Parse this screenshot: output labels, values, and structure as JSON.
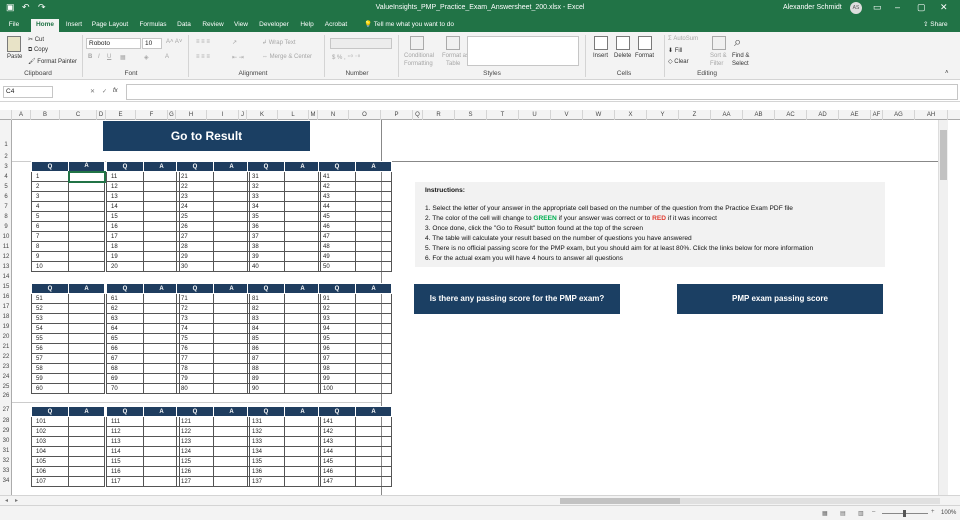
{
  "window": {
    "title": "ValueInsights_PMP_Practice_Exam_Answersheet_200.xlsx  -  Excel",
    "user": "Alexander Schmidt",
    "avatar": "AS"
  },
  "tabs": [
    "File",
    "Home",
    "Insert",
    "Page Layout",
    "Formulas",
    "Data",
    "Review",
    "View",
    "Developer",
    "Help",
    "Acrobat"
  ],
  "tell_me": "Tell me what you want to do",
  "share": "Share",
  "ribbon": {
    "clipboard": {
      "paste": "Paste",
      "cut": "Cut",
      "copy": "Copy",
      "format_painter": "Format Painter",
      "group": "Clipboard"
    },
    "font": {
      "name": "Roboto",
      "size": "10",
      "group": "Font"
    },
    "alignment": {
      "wrap": "Wrap Text",
      "merge": "Merge & Center",
      "group": "Alignment"
    },
    "number": {
      "group": "Number"
    },
    "styles": {
      "conditional": "Conditional",
      "formatting": "Formatting",
      "format_as": "Format as",
      "table": "Table",
      "group": "Styles"
    },
    "cells": {
      "insert": "Insert",
      "delete": "Delete",
      "format": "Format",
      "group": "Cells"
    },
    "editing": {
      "autosum": "AutoSum",
      "fill": "Fill",
      "clear": "Clear",
      "sort": "Sort &",
      "filter": "Filter",
      "find": "Find &",
      "select": "Select",
      "group": "Editing"
    }
  },
  "name_box": "C4",
  "fx": "fx",
  "columns": [
    "A",
    "B",
    "C",
    "D",
    "E",
    "F",
    "G",
    "H",
    "I",
    "J",
    "K",
    "L",
    "M",
    "N",
    "O",
    "P",
    "Q",
    "R",
    "S",
    "T",
    "U",
    "V",
    "W",
    "X",
    "Y",
    "Z",
    "AA",
    "AB",
    "AC",
    "AD",
    "AE",
    "AF",
    "AG",
    "AH"
  ],
  "rows": [
    "1",
    "2",
    "3",
    "4",
    "5",
    "6",
    "7",
    "8",
    "9",
    "10",
    "11",
    "12",
    "13",
    "14",
    "15",
    "16",
    "17",
    "18",
    "19",
    "20",
    "21",
    "22",
    "23",
    "24",
    "25",
    "26",
    "27",
    "28",
    "29",
    "30",
    "31",
    "32",
    "33",
    "34"
  ],
  "go_to_result": "Go to Result",
  "header_q": "Q",
  "header_a": "A",
  "block1": [
    [
      "1",
      "11",
      "21",
      "31",
      "41"
    ],
    [
      "2",
      "12",
      "22",
      "32",
      "42"
    ],
    [
      "3",
      "13",
      "23",
      "33",
      "43"
    ],
    [
      "4",
      "14",
      "24",
      "34",
      "44"
    ],
    [
      "5",
      "15",
      "25",
      "35",
      "45"
    ],
    [
      "6",
      "16",
      "26",
      "36",
      "46"
    ],
    [
      "7",
      "17",
      "27",
      "37",
      "47"
    ],
    [
      "8",
      "18",
      "28",
      "38",
      "48"
    ],
    [
      "9",
      "19",
      "29",
      "39",
      "49"
    ],
    [
      "10",
      "20",
      "30",
      "40",
      "50"
    ]
  ],
  "block2": [
    [
      "51",
      "61",
      "71",
      "81",
      "91"
    ],
    [
      "52",
      "62",
      "72",
      "82",
      "92"
    ],
    [
      "53",
      "63",
      "73",
      "83",
      "93"
    ],
    [
      "54",
      "64",
      "74",
      "84",
      "94"
    ],
    [
      "55",
      "65",
      "75",
      "85",
      "95"
    ],
    [
      "56",
      "66",
      "76",
      "86",
      "96"
    ],
    [
      "57",
      "67",
      "77",
      "87",
      "97"
    ],
    [
      "58",
      "68",
      "78",
      "88",
      "98"
    ],
    [
      "59",
      "69",
      "79",
      "89",
      "99"
    ],
    [
      "60",
      "70",
      "80",
      "90",
      "100"
    ]
  ],
  "block3": [
    [
      "101",
      "111",
      "121",
      "131",
      "141"
    ],
    [
      "102",
      "112",
      "122",
      "132",
      "142"
    ],
    [
      "103",
      "113",
      "123",
      "133",
      "143"
    ],
    [
      "104",
      "114",
      "124",
      "134",
      "144"
    ],
    [
      "105",
      "115",
      "125",
      "135",
      "145"
    ],
    [
      "106",
      "116",
      "126",
      "136",
      "146"
    ],
    [
      "107",
      "117",
      "127",
      "137",
      "147"
    ]
  ],
  "instructions": {
    "title": "Instructions:",
    "line1": "1. Select the letter of your answer in the appropriate cell based on the number of the question from the Practice Exam PDF file",
    "line2a": "2. The color of the cell will change to ",
    "green": "GREEN",
    "line2b": " if your answer was correct or to ",
    "red": "RED",
    "line2c": " if it was incorrect",
    "line3": "3. Once done, click the \"Go to Result\" button found at the top of the screen",
    "line4": "4. The table will calculate your result based on the number of questions you have answered",
    "line5": "5. There is no official passing score for the PMP exam, but you should aim for at least 80%. Click the links below for more information",
    "line6": "6. For the actual exam you will have 4 hours to answer all questions"
  },
  "link_buttons": {
    "passing_q": "Is there any passing score for the PMP exam?",
    "passing_score": "PMP exam passing score"
  },
  "status": {
    "zoom": "100%"
  },
  "colors": {
    "excel_green": "#217346",
    "navy": "#1b3f63",
    "header_navy": "#1f3d5f"
  }
}
